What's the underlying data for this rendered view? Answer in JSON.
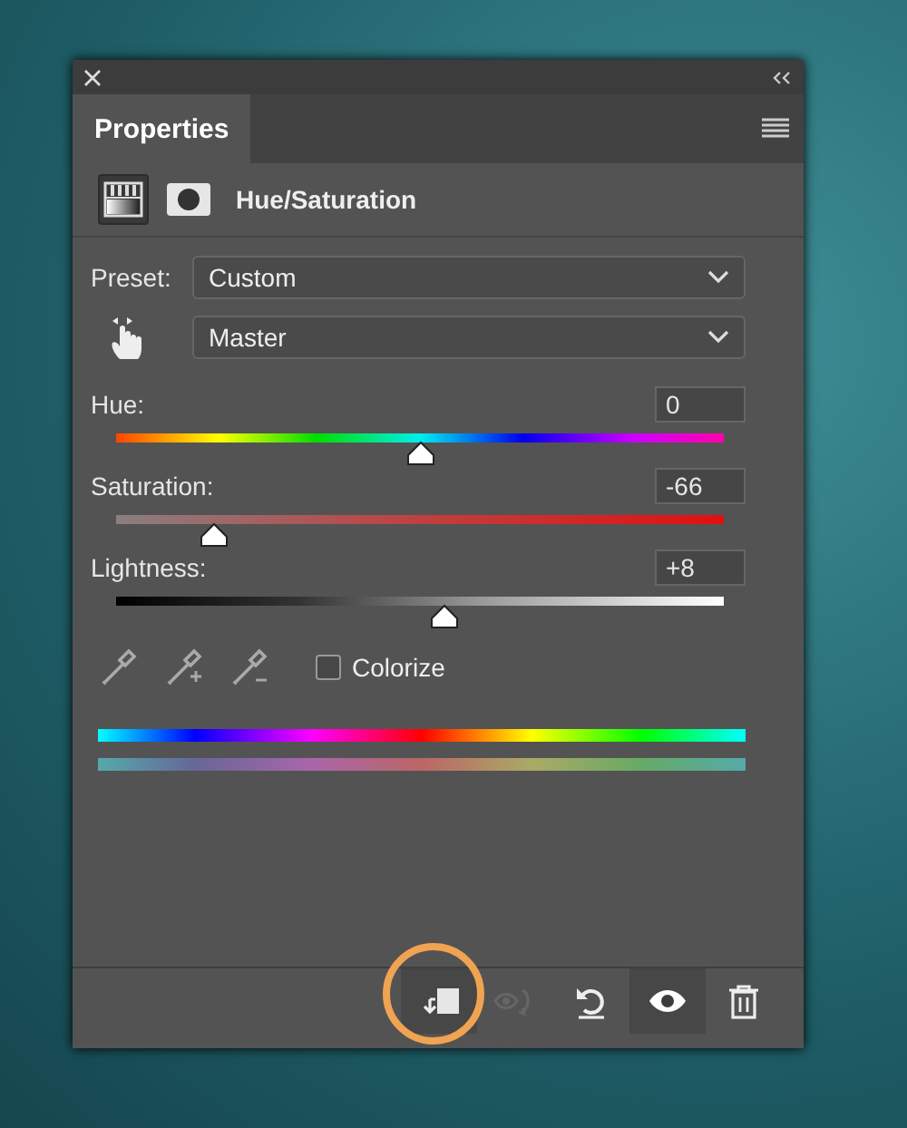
{
  "tab": {
    "label": "Properties",
    "selected": true
  },
  "header": {
    "title": "Hue/Saturation",
    "modes": [
      {
        "kind": "adjustment",
        "selected": true
      },
      {
        "kind": "mask",
        "selected": false
      }
    ]
  },
  "preset": {
    "label": "Preset:",
    "value": "Custom"
  },
  "channel": {
    "value": "Master"
  },
  "sliders": [
    {
      "kind": "hue",
      "label": "Hue:",
      "value": "0",
      "level": 0.5
    },
    {
      "kind": "saturation",
      "label": "Saturation:",
      "value": "-66",
      "level": 0.16
    },
    {
      "kind": "lightness",
      "label": "Lightness:",
      "value": "+8",
      "level": 0.54
    }
  ],
  "colorize": {
    "label": "Colorize",
    "checked": false
  },
  "footer_buttons": [
    {
      "kind": "clip",
      "active": true,
      "disabled": false,
      "annotated": true
    },
    {
      "kind": "previous-state",
      "active": false,
      "disabled": true,
      "annotated": false
    },
    {
      "kind": "reset",
      "active": false,
      "disabled": false,
      "annotated": false
    },
    {
      "kind": "visibility",
      "active": true,
      "disabled": false,
      "annotated": false
    },
    {
      "kind": "delete",
      "active": false,
      "disabled": false,
      "annotated": false
    }
  ]
}
